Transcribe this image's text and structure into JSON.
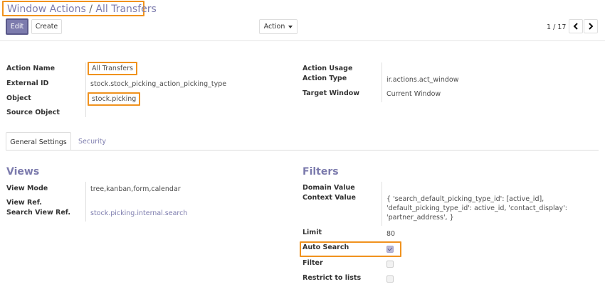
{
  "breadcrumb": {
    "parent": "Window Actions",
    "separator": "/",
    "current": "All Transfers"
  },
  "toolbar": {
    "edit_label": "Edit",
    "create_label": "Create",
    "action_label": "Action"
  },
  "pager": {
    "text": "1 / 17",
    "prev_icon": "chevron-left-icon",
    "next_icon": "chevron-right-icon"
  },
  "fields": {
    "action_name_label": "Action Name",
    "action_name": "All Transfers",
    "external_id_label": "External ID",
    "external_id": "stock.stock_picking_action_picking_type",
    "object_label": "Object",
    "object": "stock.picking",
    "source_object_label": "Source Object",
    "source_object": "",
    "action_usage_label": "Action Usage",
    "action_usage": "",
    "action_type_label": "Action Type",
    "action_type": "ir.actions.act_window",
    "target_window_label": "Target Window",
    "target_window": "Current Window"
  },
  "tabs": [
    {
      "label": "General Settings",
      "active": true
    },
    {
      "label": "Security",
      "active": false
    }
  ],
  "views": {
    "title": "Views",
    "view_mode_label": "View Mode",
    "view_mode": "tree,kanban,form,calendar",
    "view_ref_label": "View Ref.",
    "view_ref": "",
    "search_view_ref_label": "Search View Ref.",
    "search_view_ref": "stock.picking.internal.search"
  },
  "filters": {
    "title": "Filters",
    "domain_value_label": "Domain Value",
    "domain_value": "",
    "context_value_label": "Context Value",
    "context_value": "{ 'search_default_picking_type_id': [active_id], 'default_picking_type_id': active_id, 'contact_display': 'partner_address', }",
    "limit_label": "Limit",
    "limit": "80",
    "auto_search_label": "Auto Search",
    "auto_search": true,
    "filter_label": "Filter",
    "filter": false,
    "restrict_label": "Restrict to lists",
    "restrict": false
  },
  "colors": {
    "accent": "#7c7bad",
    "highlight": "#f0921e"
  }
}
